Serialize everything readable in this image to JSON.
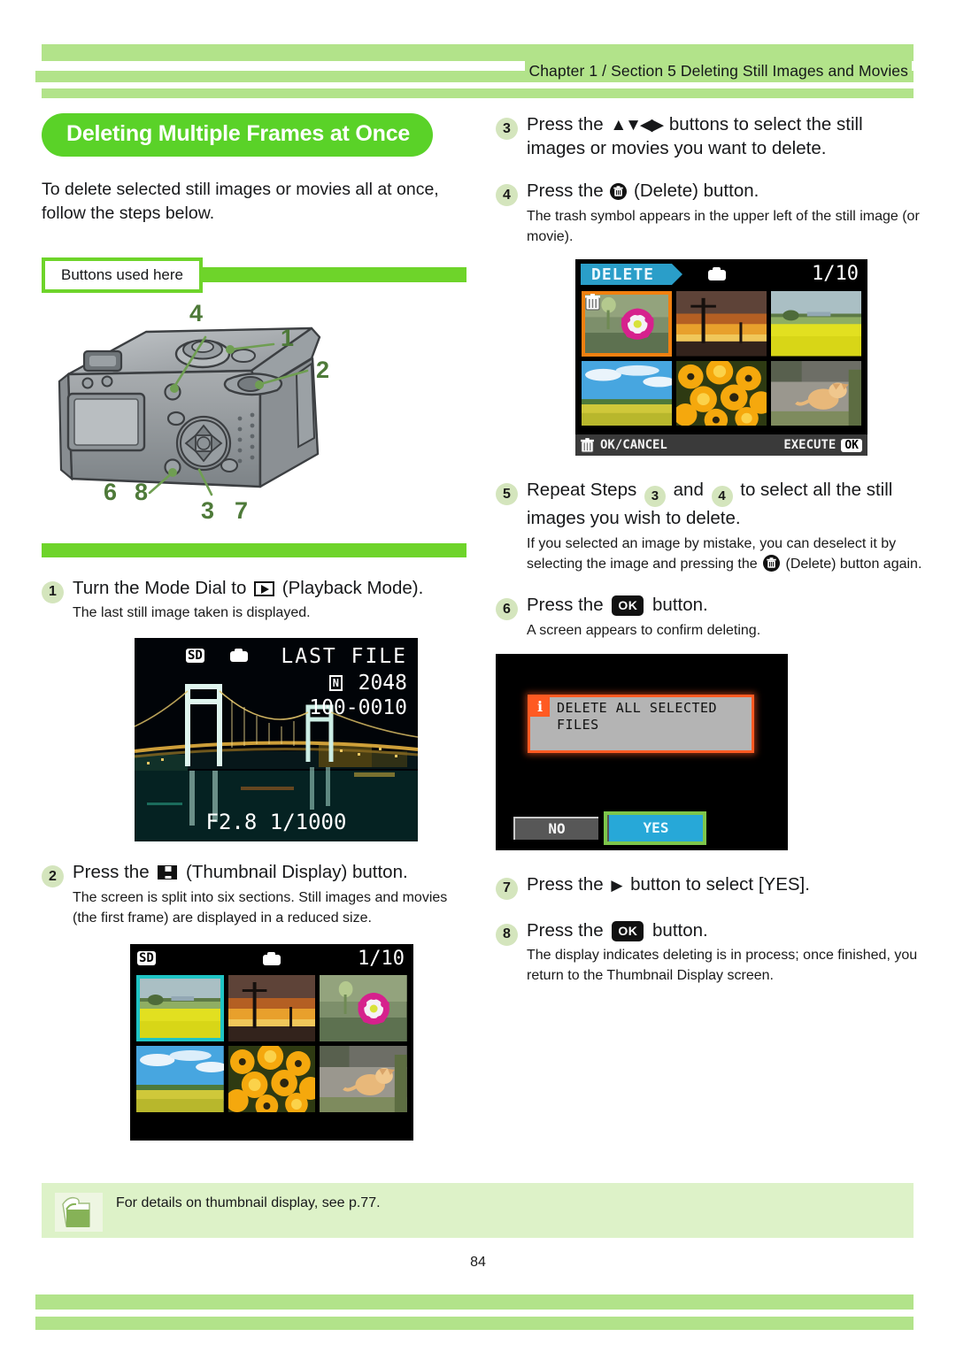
{
  "header": {
    "chapter_line": "Chapter  1 / Section 5  Deleting Still Images and Movies"
  },
  "section": {
    "title": "Deleting Multiple Frames at Once",
    "intro": "To delete selected still images or movies all at once, follow the steps below.",
    "buttons_used_label": "Buttons used here"
  },
  "camera_callouts": [
    "4",
    "1",
    "2",
    "6",
    "8",
    "3",
    "7"
  ],
  "steps": {
    "s1": {
      "num": "1",
      "head_pre": "Turn the Mode Dial to",
      "head_post": "(Playback Mode).",
      "sub": "The last still image taken is displayed."
    },
    "s2": {
      "num": "2",
      "head_pre": "Press the",
      "head_post": "(Thumbnail Display) button.",
      "sub": "The screen is split into six sections. Still images and movies (the first frame) are displayed in a reduced size."
    },
    "s3": {
      "num": "3",
      "head_pre": "Press the",
      "arrows": "▲▼◀▶",
      "head_post": "buttons to select the still images or movies you want to delete."
    },
    "s4": {
      "num": "4",
      "head_pre": "Press the",
      "head_post": "(Delete) button.",
      "sub": "The trash symbol appears in the upper left of the still image (or movie)."
    },
    "s5": {
      "num": "5",
      "head_a": "Repeat Steps",
      "ref1": "3",
      "head_b": "and",
      "ref2": "4",
      "head_c": "to select all the still images you wish to delete.",
      "sub_a": "If you selected an image by mistake, you can deselect it by selecting the image and pressing the",
      "sub_b": "(Delete) button again."
    },
    "s6": {
      "num": "6",
      "head_pre": "Press the",
      "ok_label": "OK",
      "head_post": "button.",
      "sub": "A screen appears to confirm deleting."
    },
    "s7": {
      "num": "7",
      "head_pre": "Press the",
      "arrow": "▶",
      "head_post": "button to select [YES]."
    },
    "s8": {
      "num": "8",
      "head_pre": "Press the",
      "ok_label": "OK",
      "head_post": "button.",
      "sub": "The display indicates deleting is in process; once finished, you return to the Thumbnail Display screen."
    }
  },
  "screen_last_file": {
    "sd_label": "SD",
    "title": "LAST FILE",
    "quality_badge": "N",
    "resolution": "2048",
    "file_number": "100-0010",
    "exposure": "F2.8 1/1000"
  },
  "screen_thumbnails": {
    "sd_label": "SD",
    "counter": "1/10",
    "tiles": [
      "yellow-rapeseed-field-river",
      "sunset-utility-pole",
      "pink-saxifrage-flower",
      "blue-sky-green-field",
      "orange-marigold-flowers",
      "ginger-cat-on-path"
    ],
    "selected_index": 0
  },
  "screen_delete": {
    "mode_label": "DELETE",
    "counter": "1/10",
    "tiles": [
      "pink-saxifrage-flower",
      "sunset-utility-pole",
      "yellow-rapeseed-field-river",
      "blue-sky-green-field",
      "orange-marigold-flowers",
      "ginger-cat-on-path"
    ],
    "selected_index": 0,
    "footer_left": "OK/CANCEL",
    "footer_right": "EXECUTE",
    "footer_ok": "OK"
  },
  "screen_confirm": {
    "message_line1": "DELETE ALL SELECTED",
    "message_line2": "FILES",
    "info_glyph": "i",
    "button_no": "NO",
    "button_yes": "YES",
    "selected_button": "YES"
  },
  "note": {
    "text": "For details on thumbnail display, see p.77."
  },
  "footer": {
    "page_number": "84"
  },
  "colors": {
    "header_band": "#b2e38a",
    "accent_green": "#6ed42a",
    "title_pill": "#5ad228",
    "badge_bg": "#d4e5bd",
    "note_bg": "#ddf2c8",
    "select_teal": "#1fc4c4",
    "select_orange": "#f08010",
    "delete_tag": "#2a9ec9",
    "alert_orange": "#ff5a22",
    "yes_blue": "#27a8d8",
    "yes_frame": "#7ec64b"
  }
}
